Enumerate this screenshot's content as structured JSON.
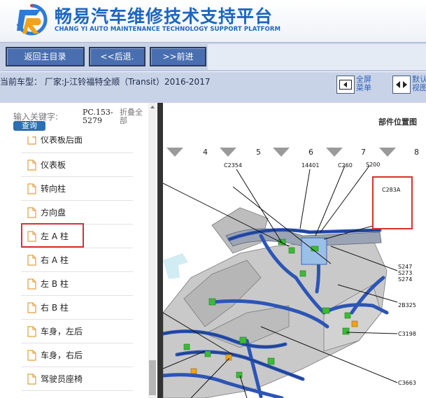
{
  "header": {
    "title_cn": "畅易汽车维修技术支持平台",
    "title_en": "CHANG YI AUTO MAINTENANCE TECHNOLOGY SUPPORT PLATFORM"
  },
  "nav": {
    "home": "返回主目录",
    "back": "<<后退.",
    "forward": ">>前进"
  },
  "car": {
    "label": "当前车型：  厂家:J-江铃福特全顺（Transit）2016-2017"
  },
  "controls": {
    "fullscreen": "全屏菜单",
    "view": "默认视图"
  },
  "sidebar": {
    "search_label": "输入关键字:",
    "search_button": "查询",
    "pc_code": "PC.153-5279",
    "collapse": "折叠全部",
    "items": [
      {
        "label": "仪表板后面"
      },
      {
        "label": "仪表板"
      },
      {
        "label": "转向柱"
      },
      {
        "label": "方向盘"
      },
      {
        "label": "左 A 柱"
      },
      {
        "label": "右 A 柱"
      },
      {
        "label": "左 B 柱"
      },
      {
        "label": "右 B 柱"
      },
      {
        "label": "车身，左后"
      },
      {
        "label": "车身，右后"
      },
      {
        "label": "驾驶员座椅"
      }
    ]
  },
  "diagram": {
    "title": "部件位置图",
    "ticks": [
      "4",
      "5",
      "6",
      "7",
      "8"
    ],
    "connectors": {
      "c2354": "C2354",
      "n14401": "14401",
      "c260": "C260",
      "s200": "S200",
      "c283a": "C283A",
      "s247": "S247",
      "s273": "S273",
      "s274": "S274",
      "b2b325": "2B325",
      "c3198": "C3198",
      "c3663": "C3663"
    }
  },
  "colors": {
    "brand_blue": "#1d66c0",
    "nav_button": "#4a6fb0",
    "highlight_red": "#d9302c",
    "harness_blue": "#2c55b5",
    "connector_green": "#3fb83a"
  }
}
